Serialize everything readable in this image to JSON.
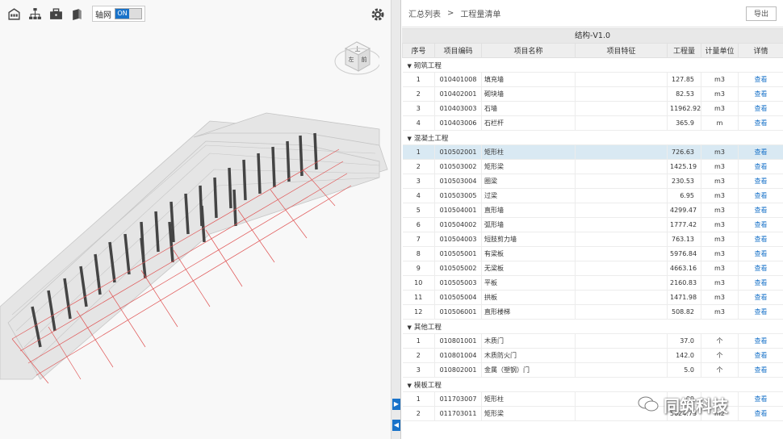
{
  "toolbar": {
    "icons": [
      "building-icon",
      "hierarchy-icon",
      "toolbox-icon",
      "box-icon"
    ],
    "axis_label": "轴网",
    "axis_toggle": "ON"
  },
  "viewcube": {
    "top": "上",
    "left": "左",
    "front": "前"
  },
  "breadcrumb": {
    "root": "汇总列表",
    "sep": ">",
    "current": "工程量清单"
  },
  "export_label": "导出",
  "version": "结构-V1.0",
  "columns": [
    "序号",
    "项目编码",
    "项目名称",
    "项目特征",
    "工程量",
    "计量单位",
    "详情"
  ],
  "groups": [
    {
      "name": "砌筑工程",
      "rows": [
        {
          "no": "1",
          "code": "010401008",
          "name": "填充墙",
          "qty": "127.85",
          "unit": "m3",
          "detail": "查看"
        },
        {
          "no": "2",
          "code": "010402001",
          "name": "砌块墙",
          "qty": "82.53",
          "unit": "m3",
          "detail": "查看"
        },
        {
          "no": "3",
          "code": "010403003",
          "name": "石墙",
          "qty": "11962.92",
          "unit": "m3",
          "detail": "查看"
        },
        {
          "no": "4",
          "code": "010403006",
          "name": "石栏杆",
          "qty": "365.9",
          "unit": "m",
          "detail": "查看"
        }
      ]
    },
    {
      "name": "混凝土工程",
      "rows": [
        {
          "no": "1",
          "code": "010502001",
          "name": "矩形柱",
          "qty": "726.63",
          "unit": "m3",
          "detail": "查看",
          "selected": true
        },
        {
          "no": "2",
          "code": "010503002",
          "name": "矩形梁",
          "qty": "1425.19",
          "unit": "m3",
          "detail": "查看"
        },
        {
          "no": "3",
          "code": "010503004",
          "name": "圈梁",
          "qty": "230.53",
          "unit": "m3",
          "detail": "查看"
        },
        {
          "no": "4",
          "code": "010503005",
          "name": "过梁",
          "qty": "6.95",
          "unit": "m3",
          "detail": "查看"
        },
        {
          "no": "5",
          "code": "010504001",
          "name": "直形墙",
          "qty": "4299.47",
          "unit": "m3",
          "detail": "查看"
        },
        {
          "no": "6",
          "code": "010504002",
          "name": "弧形墙",
          "qty": "1777.42",
          "unit": "m3",
          "detail": "查看"
        },
        {
          "no": "7",
          "code": "010504003",
          "name": "短肢剪力墙",
          "qty": "763.13",
          "unit": "m3",
          "detail": "查看"
        },
        {
          "no": "8",
          "code": "010505001",
          "name": "有梁板",
          "qty": "5976.84",
          "unit": "m3",
          "detail": "查看"
        },
        {
          "no": "9",
          "code": "010505002",
          "name": "无梁板",
          "qty": "4663.16",
          "unit": "m3",
          "detail": "查看"
        },
        {
          "no": "10",
          "code": "010505003",
          "name": "平板",
          "qty": "2160.83",
          "unit": "m3",
          "detail": "查看"
        },
        {
          "no": "11",
          "code": "010505004",
          "name": "拱板",
          "qty": "1471.98",
          "unit": "m3",
          "detail": "查看"
        },
        {
          "no": "12",
          "code": "010506001",
          "name": "直形楼梯",
          "qty": "508.82",
          "unit": "m3",
          "detail": "查看"
        }
      ]
    },
    {
      "name": "其他工程",
      "rows": [
        {
          "no": "1",
          "code": "010801001",
          "name": "木质门",
          "qty": "37.0",
          "unit": "个",
          "detail": "查看"
        },
        {
          "no": "2",
          "code": "010801004",
          "name": "木质防火门",
          "qty": "142.0",
          "unit": "个",
          "detail": "查看"
        },
        {
          "no": "3",
          "code": "010802001",
          "name": "金属（塑钢）门",
          "qty": "5.0",
          "unit": "个",
          "detail": "查看"
        }
      ]
    },
    {
      "name": "模板工程",
      "rows": [
        {
          "no": "1",
          "code": "011703007",
          "name": "矩形柱",
          "qty": "00",
          "unit": "",
          "detail": "查看"
        },
        {
          "no": "2",
          "code": "011703011",
          "name": "矩形梁",
          "qty": "5024.73",
          "unit": "m2",
          "detail": "查看"
        }
      ]
    }
  ],
  "watermark": "同筑科技"
}
